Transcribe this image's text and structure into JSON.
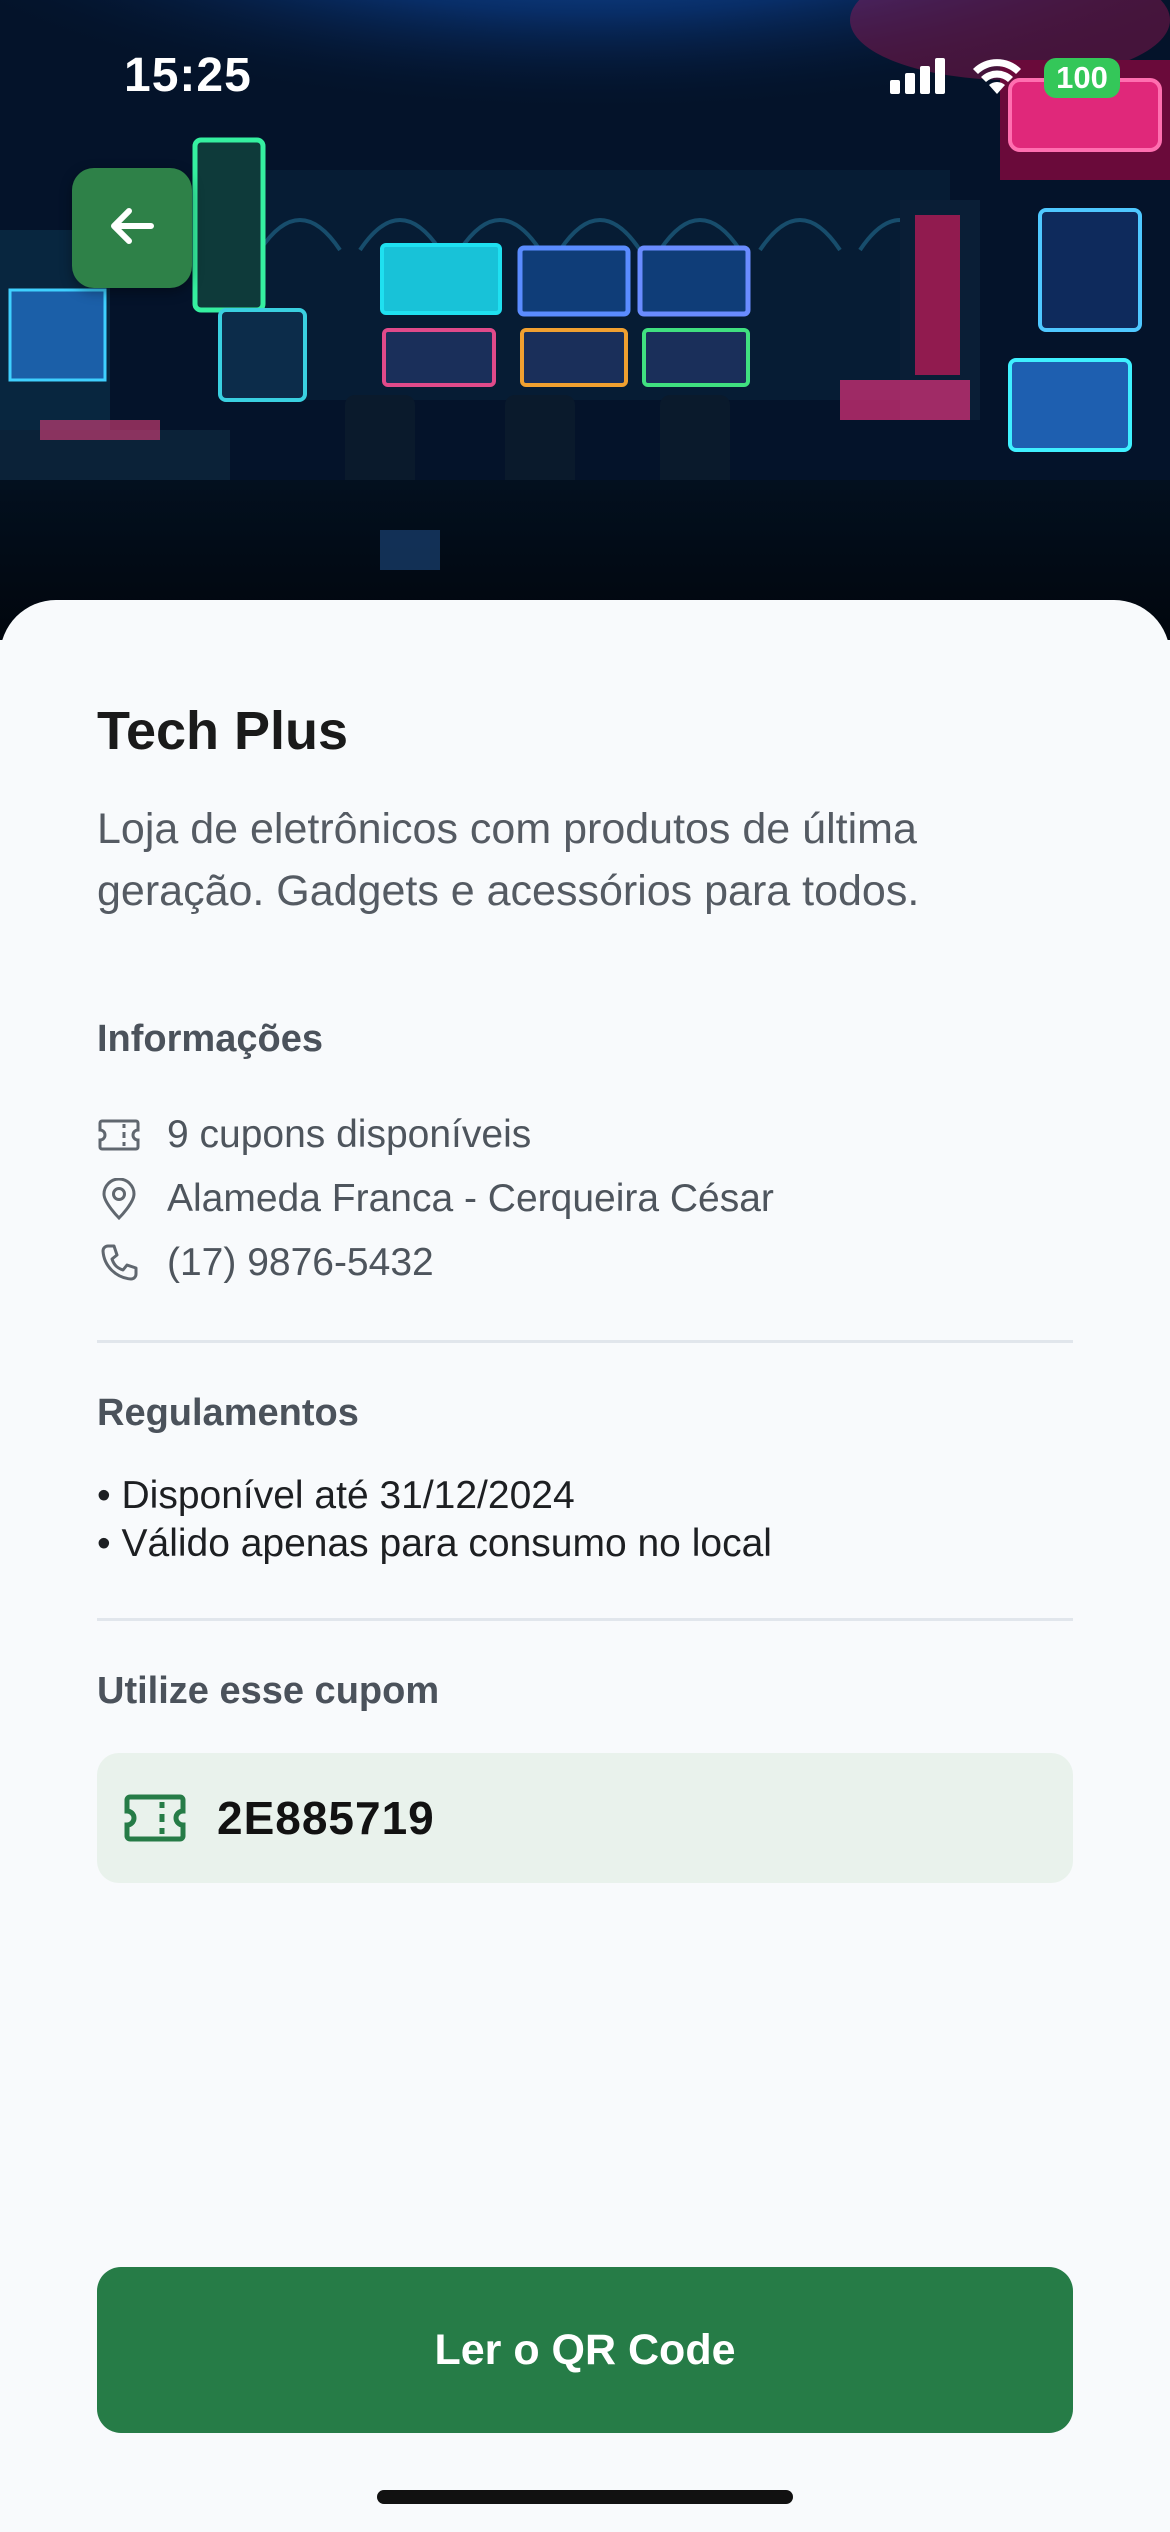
{
  "status_bar": {
    "time": "15:25",
    "battery": "100",
    "icons": [
      "signal-icon",
      "wifi-icon",
      "battery-icon"
    ]
  },
  "hero": {
    "image": "arcade-room-photo",
    "back_icon": "arrow-left-icon"
  },
  "store": {
    "name": "Tech Plus",
    "description": "Loja de eletrônicos com produtos de última geração. Gadgets e acessórios para todos."
  },
  "info": {
    "title": "Informações",
    "items": [
      {
        "icon": "ticket-icon",
        "text": "9 cupons disponíveis"
      },
      {
        "icon": "location-pin-icon",
        "text": "Alameda Franca - Cerqueira César"
      },
      {
        "icon": "phone-icon",
        "text": "(17) 9876-5432"
      }
    ]
  },
  "rules": {
    "title": "Regulamentos",
    "items": [
      "• Disponível até 31/12/2024",
      "• Válido apenas para consumo no local"
    ]
  },
  "coupon": {
    "title": "Utilize esse cupom",
    "code": "2E885719",
    "icon": "ticket-icon"
  },
  "actions": {
    "qr_button": "Ler o QR Code"
  },
  "colors": {
    "primary": "#267c47",
    "back_button": "#2e8148",
    "coupon_bg": "#e9f2ec",
    "background": "#f8fafc"
  }
}
